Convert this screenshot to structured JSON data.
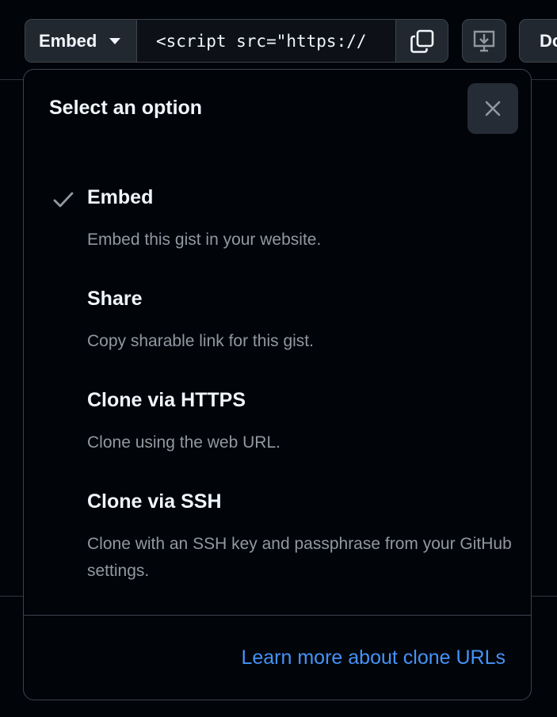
{
  "toolbar": {
    "embed_label": "Embed",
    "embed_value": "<script src=\"https://",
    "download_label": "Do"
  },
  "menu": {
    "title": "Select an option",
    "options": [
      {
        "label": "Embed",
        "description": "Embed this gist in your website.",
        "selected": true
      },
      {
        "label": "Share",
        "description": "Copy sharable link for this gist.",
        "selected": false
      },
      {
        "label": "Clone via HTTPS",
        "description": "Clone using the web URL.",
        "selected": false
      },
      {
        "label": "Clone via SSH",
        "description": "Clone with an SSH key and passphrase from your GitHub settings.",
        "selected": false
      }
    ],
    "footer_link": "Learn more about clone URLs"
  },
  "icons": {
    "caret": "chevron-down-icon",
    "copy": "copy-icon",
    "desktop": "desktop-download-icon",
    "close": "close-icon",
    "check": "check-icon"
  },
  "colors": {
    "background": "#010409",
    "border": "#3d444d",
    "text_primary": "#f0f6fc",
    "text_muted": "#9198a1",
    "link": "#4493f8"
  }
}
